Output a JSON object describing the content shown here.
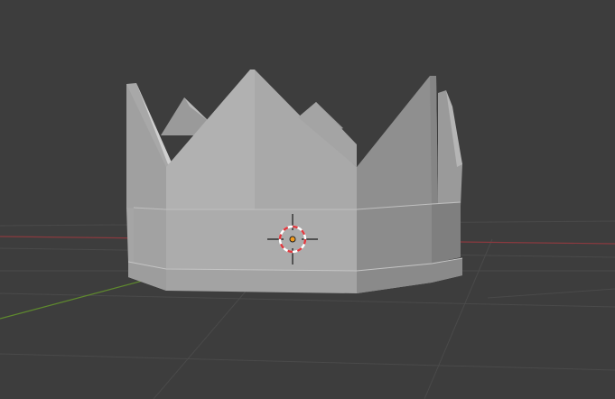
{
  "viewport": {
    "background": "#3d3d3d",
    "grid_color": "#4a4a4a",
    "x_axis_color": "#8a3a3f",
    "y_axis_color": "#5f8a2e",
    "object": {
      "name": "crown",
      "colors": {
        "light": "#b2b2b2",
        "mid": "#a6a6a6",
        "dark": "#8f8f8f",
        "darker": "#7e7e7e",
        "edge": "#cfcfcf"
      }
    },
    "cursor": {
      "icon": "3d-cursor-icon",
      "ring_red": "#e0383e",
      "ring_white": "#ffffff",
      "crosshair": "#1a1a1a"
    },
    "origin": {
      "icon": "object-origin-icon",
      "color": "#f29b1d"
    }
  }
}
